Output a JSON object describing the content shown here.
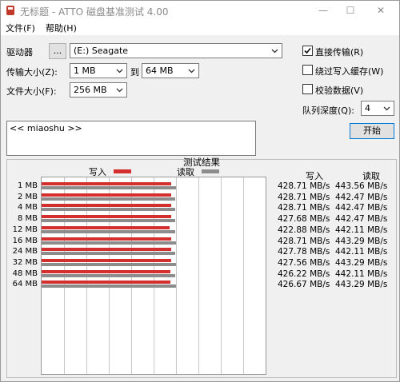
{
  "window": {
    "title": "无标题 - ATTO 磁盘基准测试 4.00"
  },
  "menu": [
    "文件(F)",
    "帮助(H)"
  ],
  "form": {
    "drive_label": "驱动器",
    "browse_label": "...",
    "drive_value": "(E:) Seagate",
    "transfer_label": "传输大小(Z):",
    "transfer_from": "1 MB",
    "to_label": "到",
    "transfer_to": "64 MB",
    "filesize_label": "文件大小(F):",
    "filesize_value": "256 MB",
    "direct_io_label": "直接传输(R)",
    "bypass_cache_label": "绕过写入缓存(W)",
    "verify_label": "校验数据(V)",
    "queue_label": "队列深度(Q):",
    "queue_value": "4",
    "start_label": "开始",
    "description": "<< miaoshu >>"
  },
  "checkboxes": {
    "direct_io": true,
    "bypass_cache": false,
    "verify": false
  },
  "chart_data": {
    "type": "bar",
    "title": "测试结果",
    "legend": [
      {
        "name": "写入",
        "color": "#d32f2f"
      },
      {
        "name": "读取",
        "color": "#8c8c8c"
      }
    ],
    "categories": [
      "1 MB",
      "2 MB",
      "4 MB",
      "8 MB",
      "12 MB",
      "16 MB",
      "24 MB",
      "32 MB",
      "48 MB",
      "64 MB"
    ],
    "series": [
      {
        "name": "写入",
        "values": [
          428.71,
          428.71,
          428.71,
          427.68,
          422.88,
          428.71,
          427.78,
          427.56,
          426.22,
          426.67
        ]
      },
      {
        "name": "读取",
        "values": [
          443.56,
          442.47,
          442.47,
          442.47,
          442.11,
          443.29,
          442.11,
          443.29,
          442.11,
          443.29
        ]
      }
    ],
    "write_header": "写入",
    "read_header": "读取",
    "write_labels": [
      "428.71 MB/s",
      "428.71 MB/s",
      "428.71 MB/s",
      "427.68 MB/s",
      "422.88 MB/s",
      "428.71 MB/s",
      "427.78 MB/s",
      "427.56 MB/s",
      "426.22 MB/s",
      "426.67 MB/s"
    ],
    "read_labels": [
      "443.56 MB/s",
      "442.47 MB/s",
      "442.47 MB/s",
      "442.47 MB/s",
      "442.11 MB/s",
      "443.29 MB/s",
      "442.11 MB/s",
      "443.29 MB/s",
      "442.11 MB/s",
      "443.29 MB/s"
    ],
    "colors": {
      "write": "#d32f2f",
      "read": "#8c8c8c"
    }
  }
}
